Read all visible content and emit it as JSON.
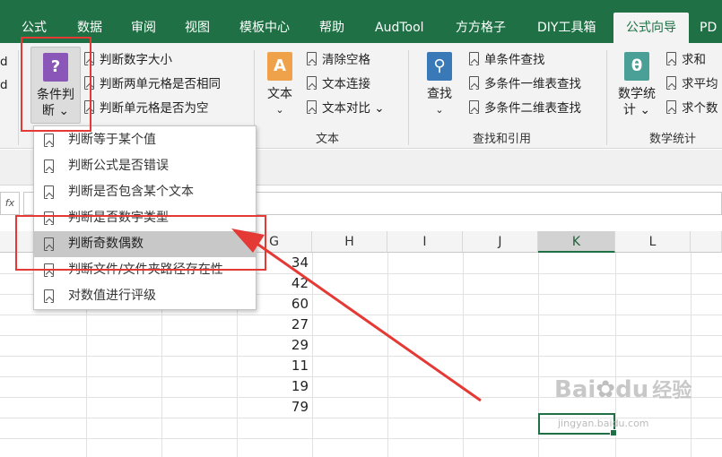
{
  "tabs": [
    "公式",
    "数据",
    "审阅",
    "视图",
    "模板中心",
    "帮助",
    "AudTool",
    "方方格子",
    "DIY工具箱",
    "公式向导",
    "PD"
  ],
  "active_tab": "公式向导",
  "ribbon": {
    "left_edge": [
      "d",
      "d"
    ],
    "condition_btn": {
      "line1": "条件判",
      "line2": "断 ⌄"
    },
    "condition_items": [
      "判断数字大小",
      "判断两单元格是否相同",
      "判断单元格是否为空"
    ],
    "text_btn": {
      "line1": "文本",
      "line2": "⌄"
    },
    "text_items": [
      "清除空格",
      "文本连接",
      "文本对比 ⌄"
    ],
    "text_group": "文本",
    "find_btn": {
      "line1": "查找",
      "line2": "⌄"
    },
    "find_items": [
      "单条件查找",
      "多条件一维表查找",
      "多条件二维表查找"
    ],
    "find_group": "查找和引用",
    "math_btn": {
      "line1": "数学统",
      "line2": "计 ⌄"
    },
    "math_items": [
      "求和",
      "求平均",
      "求个数"
    ],
    "math_group": "数学统计"
  },
  "namebox": "fx",
  "columns": [
    "G",
    "H",
    "I",
    "J",
    "K",
    "L"
  ],
  "active_column": "K",
  "g_values": [
    "34",
    "42",
    "60",
    "27",
    "29",
    "11",
    "19",
    "79"
  ],
  "dropdown_items": [
    "判断等于某个值",
    "判断公式是否错误",
    "判断是否包含某个文本",
    "判断是否数字类型",
    "判断奇数偶数",
    "判断文件/文件夹路径存在性",
    "对数值进行评级"
  ],
  "highlighted_item": "判断奇数偶数",
  "colors": {
    "ribbon_green": "#1f7145",
    "annotation_red": "#e53935",
    "condition_icon": "#8a57b8",
    "text_icon": "#f0a24a",
    "find_icon": "#3a79b8",
    "math_icon": "#4a9f96"
  },
  "watermark": {
    "brand": "Bai",
    "brand2": "du",
    "suffix": "经验",
    "url": "jingyan.baidu.com"
  }
}
